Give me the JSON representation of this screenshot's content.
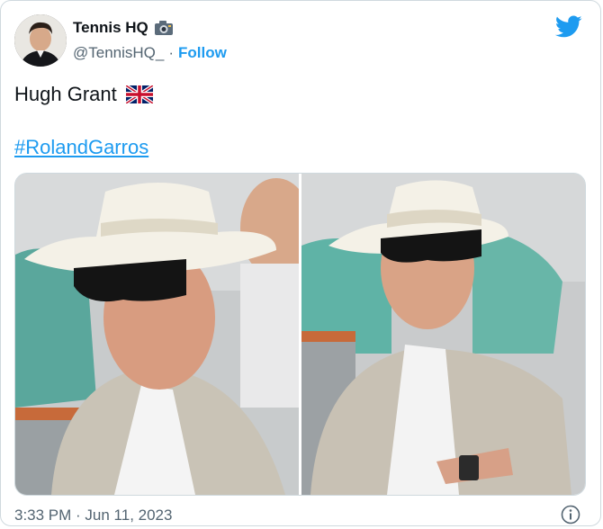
{
  "author": {
    "display_name": "Tennis HQ",
    "handle": "@TennisHQ_",
    "separator": "·",
    "follow_label": "Follow",
    "badge_icon": "camera-icon",
    "avatar_icon": "avatar"
  },
  "tweet": {
    "text": "Hugh Grant",
    "flag_icon": "uk-flag-icon",
    "hashtag": "#RolandGarros"
  },
  "media": {
    "photos": [
      {
        "label": "photo-1"
      },
      {
        "label": "photo-2"
      }
    ]
  },
  "footer": {
    "timestamp": "3:33 PM · Jun 11, 2023",
    "info_icon": "info-icon"
  },
  "colors": {
    "accent": "#1d9bf0",
    "secondary_text": "#536471",
    "border": "#cfd9de"
  }
}
